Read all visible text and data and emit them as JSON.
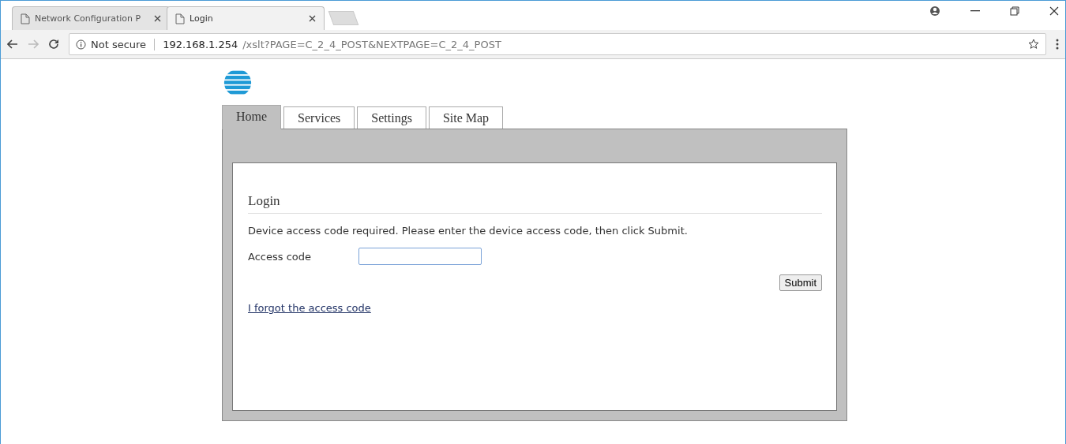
{
  "browser": {
    "tabs": [
      {
        "title": "Network Configuration P",
        "selected": false
      },
      {
        "title": "Login",
        "selected": true
      }
    ],
    "address": {
      "security": "Not secure",
      "host": "192.168.1.254",
      "path": "/xslt?PAGE=C_2_4_POST&NEXTPAGE=C_2_4_POST"
    }
  },
  "nav_tabs": [
    {
      "label": "Home",
      "selected": true
    },
    {
      "label": "Services",
      "selected": false
    },
    {
      "label": "Settings",
      "selected": false
    },
    {
      "label": "Site Map",
      "selected": false
    }
  ],
  "login": {
    "heading": "Login",
    "message": "Device access code required. Please enter the device access code, then click Submit.",
    "field_label": "Access code",
    "submit": "Submit",
    "forgot_link": "I forgot the access code"
  }
}
